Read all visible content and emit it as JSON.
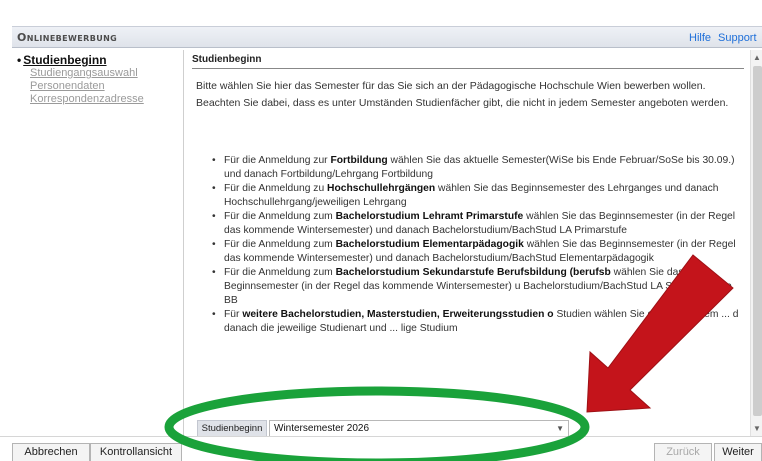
{
  "header": {
    "title": "Onlinebewerbung",
    "links": [
      "Hilfe",
      "Support"
    ]
  },
  "sidebar": {
    "items": [
      {
        "label": "Studienbeginn",
        "active": true
      },
      {
        "label": "Studiengangsauswahl",
        "active": false
      },
      {
        "label": "Personendaten",
        "active": false
      },
      {
        "label": "Korrespondenzadresse",
        "active": false
      }
    ]
  },
  "content": {
    "section_title": "Studienbeginn",
    "intro": "Bitte wählen Sie hier das Semester für das Sie sich an der Pädagogische Hochschule Wien bewerben wollen. Beachten Sie dabei, dass es unter Umständen Studienfächer gibt, die nicht in jedem Semester angeboten werden.",
    "bullets": [
      {
        "pre": "Für die Anmeldung zur ",
        "bold": "Fortbildung",
        "post": " wählen Sie das aktuelle Semester(WiSe bis Ende Februar/SoSe bis 30.09.) und danach Fortbildung/Lehrgang Fortbildung"
      },
      {
        "pre": "Für die Anmeldung zu ",
        "bold": "Hochschullehrgängen",
        "post": " wählen Sie das Beginnsemester des Lehrganges und danach Hochschullehrgang/jeweiligen Lehrgang"
      },
      {
        "pre": "Für die Anmeldung zum ",
        "bold": "Bachelorstudium Lehramt Primarstufe",
        "post": " wählen Sie das Beginnsemester (in der Regel das kommende Wintersemester) und danach Bachelorstudium/BachStud LA Primarstufe"
      },
      {
        "pre": "Für die Anmeldung zum ",
        "bold": "Bachelorstudium Elementarpädagogik",
        "post": " wählen Sie das Beginnsemester (in der Regel das kommende Wintersemester) und danach Bachelorstudium/BachStud Elementarpädagogik"
      },
      {
        "pre": "Für die Anmeldung zum ",
        "bold": "Bachelorstudium Sekundarstufe Berufsbildung (berufsb",
        "post": " wählen Sie das Beginnsemester (in der Regel das kommende Wintersemester) u Bachelorstudium/BachStud LA Sekundarstufe BB"
      },
      {
        "pre": "Für ",
        "bold": "weitere Bachelorstudien, Masterstudien, Erweiterungsstudien o",
        "post": " Studien wählen Sie das Beginnsem ... d danach die jeweilige Studienart und ... lige Studium"
      }
    ],
    "field": {
      "label": "Studienbeginn",
      "value": "Wintersemester 2026"
    }
  },
  "footer": {
    "cancel": "Abbrechen",
    "overview": "Kontrollansicht",
    "back": "Zurück",
    "next": "Weiter"
  },
  "colors": {
    "link": "#1e6fd9",
    "annotation_arrow": "#c4141b",
    "annotation_ellipse": "#1aa23a"
  },
  "icons": [
    "bullet-icon",
    "scroll-up-arrow-icon",
    "scroll-down-arrow-icon",
    "dropdown-arrow-icon",
    "annotation-arrow-icon"
  ]
}
